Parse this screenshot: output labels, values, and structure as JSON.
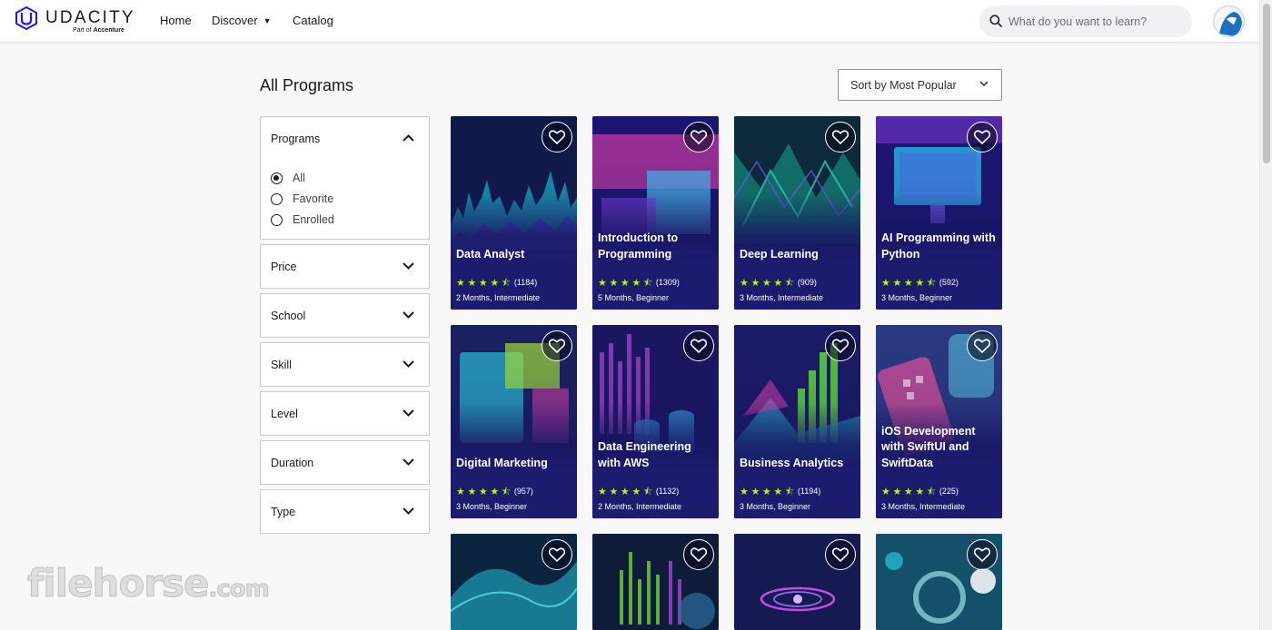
{
  "brand": {
    "name": "UDACITY",
    "tagline_prefix": "Part of",
    "tagline_company": "Accenture",
    "color": "#2015ff"
  },
  "nav": {
    "home": "Home",
    "discover": "Discover",
    "catalog": "Catalog"
  },
  "search": {
    "placeholder": "What do you want to learn?"
  },
  "page": {
    "title": "All Programs"
  },
  "sort": {
    "selected": "Sort by Most Popular"
  },
  "filters": {
    "programs": {
      "title": "Programs",
      "expanded": true,
      "options": [
        "All",
        "Favorite",
        "Enrolled"
      ],
      "selected": "All"
    },
    "price": "Price",
    "school": "School",
    "skill": "Skill",
    "level": "Level",
    "duration": "Duration",
    "type": "Type"
  },
  "cards": [
    {
      "title": "Data Analyst",
      "rating": 4.5,
      "count": "(1184)",
      "meta": "2 Months, Intermediate"
    },
    {
      "title": "Introduction to Programming",
      "rating": 4.5,
      "count": "(1309)",
      "meta": "5 Months, Beginner"
    },
    {
      "title": "Deep Learning",
      "rating": 4.5,
      "count": "(909)",
      "meta": "3 Months, Intermediate"
    },
    {
      "title": "AI Programming with Python",
      "rating": 4.5,
      "count": "(592)",
      "meta": "3 Months, Beginner"
    },
    {
      "title": "Digital Marketing",
      "rating": 4.5,
      "count": "(957)",
      "meta": "3 Months, Beginner"
    },
    {
      "title": "Data Engineering with AWS",
      "rating": 4.5,
      "count": "(1132)",
      "meta": "2 Months, Intermediate"
    },
    {
      "title": "Business Analytics",
      "rating": 4.5,
      "count": "(1194)",
      "meta": "3 Months, Beginner"
    },
    {
      "title": "iOS Development with SwiftUI and SwiftData",
      "rating": 4.5,
      "count": "(225)",
      "meta": "3 Months, Intermediate"
    }
  ],
  "watermark": {
    "main": "filehorse",
    "suffix": ".com"
  },
  "colors": {
    "accent_star": "#b5f31b",
    "card_bg": "#1d1b6e"
  }
}
